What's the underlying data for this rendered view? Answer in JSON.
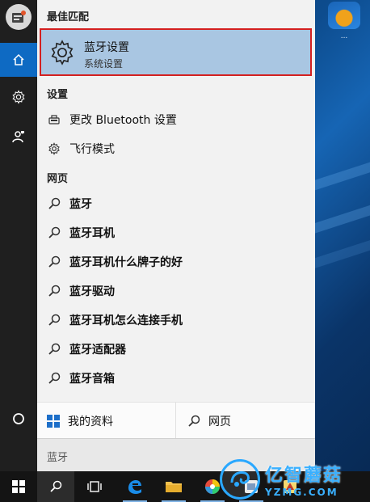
{
  "desktop": {
    "icon_label": "..."
  },
  "start_menu": {
    "best_match": {
      "header": "最佳匹配",
      "title": "蓝牙设置",
      "subtitle": "系统设置"
    },
    "settings": {
      "header": "设置",
      "items": [
        {
          "label": "更改 Bluetooth 设置",
          "icon": "bluetooth-device-icon"
        },
        {
          "label": "飞行模式",
          "icon": "gear-icon"
        }
      ]
    },
    "web": {
      "header": "网页",
      "items": [
        {
          "prefix": "蓝牙",
          "rest": ""
        },
        {
          "prefix": "蓝牙",
          "rest": "耳机"
        },
        {
          "prefix": "蓝牙",
          "rest": "耳机什么牌子的好"
        },
        {
          "prefix": "蓝牙",
          "rest": "驱动"
        },
        {
          "prefix": "蓝牙",
          "rest": "耳机怎么连接手机"
        },
        {
          "prefix": "蓝牙",
          "rest": "适配器"
        },
        {
          "prefix": "蓝牙",
          "rest": "音箱"
        }
      ]
    },
    "bottom": {
      "my_stuff": "我的资料",
      "web": "网页"
    },
    "search": {
      "value": "蓝牙"
    }
  },
  "watermark": {
    "title": "亿智蘑菇",
    "url": "YZMG.COM"
  },
  "colors": {
    "accent": "#0e6ac3",
    "highlight": "#a9c6e2",
    "highlight_border": "#d42020",
    "rail": "#1f1f1f",
    "taskbar": "#141414"
  }
}
